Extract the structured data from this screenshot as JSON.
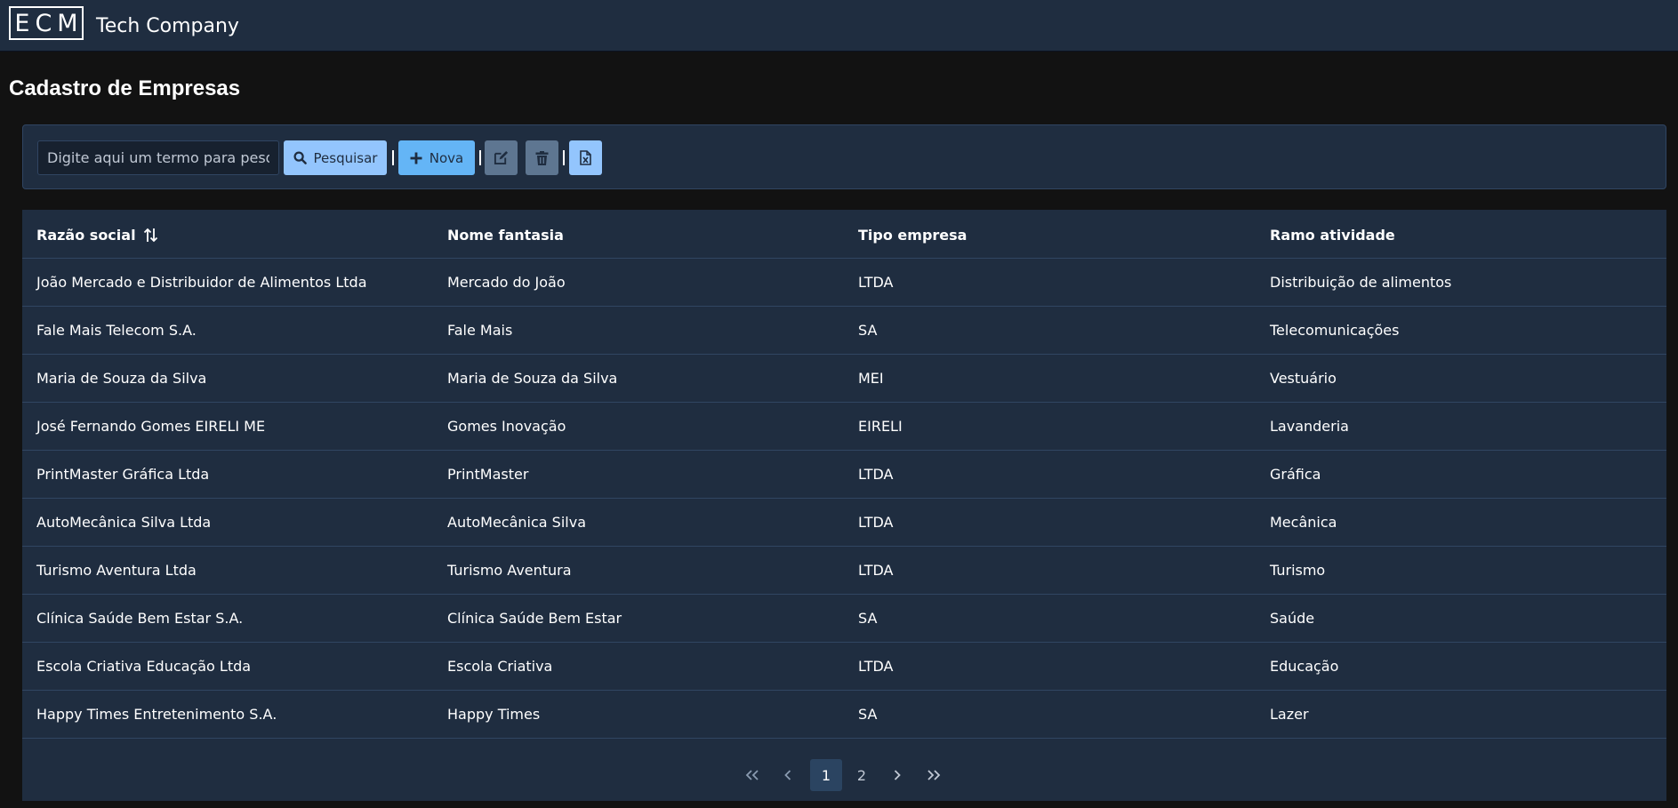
{
  "header": {
    "logo": "ECM",
    "company": "Tech Company"
  },
  "page": {
    "title": "Cadastro de Empresas"
  },
  "toolbar": {
    "search_placeholder": "Digite aqui um termo para pesquisa",
    "search_value": "",
    "search_label": "Pesquisar",
    "new_label": "Nova",
    "separator": "|"
  },
  "table": {
    "columns": [
      "Razão social",
      "Nome fantasia",
      "Tipo empresa",
      "Ramo atividade"
    ],
    "rows": [
      [
        "João Mercado e Distribuidor de Alimentos Ltda",
        "Mercado do João",
        "LTDA",
        "Distribuição de alimentos"
      ],
      [
        "Fale Mais Telecom S.A.",
        "Fale Mais",
        "SA",
        "Telecomunicações"
      ],
      [
        "Maria de Souza da Silva",
        "Maria de Souza da Silva",
        "MEI",
        "Vestuário"
      ],
      [
        "José Fernando Gomes EIRELI ME",
        "Gomes Inovação",
        "EIRELI",
        "Lavanderia"
      ],
      [
        "PrintMaster Gráfica Ltda",
        "PrintMaster",
        "LTDA",
        "Gráfica"
      ],
      [
        "AutoMecânica Silva Ltda",
        "AutoMecânica Silva",
        "LTDA",
        "Mecânica"
      ],
      [
        "Turismo Aventura Ltda",
        "Turismo Aventura",
        "LTDA",
        "Turismo"
      ],
      [
        "Clínica Saúde Bem Estar S.A.",
        "Clínica Saúde Bem Estar",
        "SA",
        "Saúde"
      ],
      [
        "Escola Criativa Educação Ltda",
        "Escola Criativa",
        "LTDA",
        "Educação"
      ],
      [
        "Happy Times Entretenimento S.A.",
        "Happy Times",
        "SA",
        "Lazer"
      ]
    ]
  },
  "pagination": {
    "first": "«",
    "prev": "‹",
    "next": "›",
    "last": "»",
    "pages": [
      "1",
      "2"
    ],
    "current": "1"
  },
  "icons": {
    "search": "search-icon",
    "new": "plus-icon",
    "edit": "edit-icon",
    "delete": "trash-icon",
    "export": "excel-file-icon",
    "sort": "sort-icon"
  },
  "colors": {
    "background": "#121212",
    "panel": "#1f2d40",
    "border": "#304562",
    "button_light": "#93c5fd",
    "button_blue": "#64b5f6",
    "button_gray": "#5e7691"
  }
}
